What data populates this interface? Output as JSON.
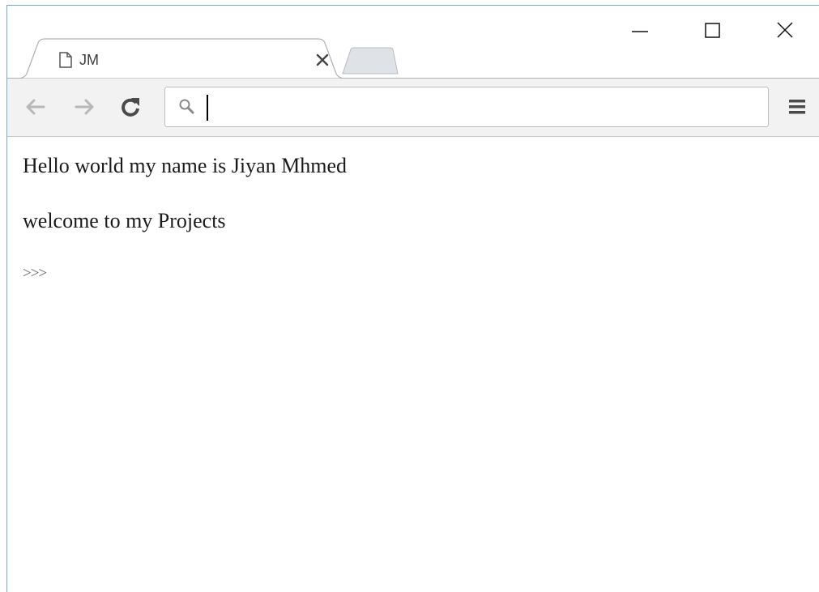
{
  "browser": {
    "tab": {
      "title": "JM",
      "favicon": "page-icon",
      "close": "close-icon"
    },
    "new_tab": "new-tab-button",
    "window_controls": [
      "minimize-icon",
      "maximize-icon",
      "close-icon"
    ],
    "toolbar": {
      "back": "back-arrow-icon",
      "forward": "forward-arrow-icon",
      "reload": "reload-icon",
      "menu": "hamburger-menu-icon"
    },
    "omnibox": {
      "icon": "search-icon",
      "value": "",
      "placeholder": ""
    }
  },
  "page": {
    "lines": [
      "Hello world my name is Jiyan Mhmed",
      "welcome to my Projects",
      ">>>"
    ]
  },
  "colors": {
    "window_border": "#6fa9d4",
    "toolbar_bg": "#f2f2f2",
    "text": "#1a1a1a"
  }
}
